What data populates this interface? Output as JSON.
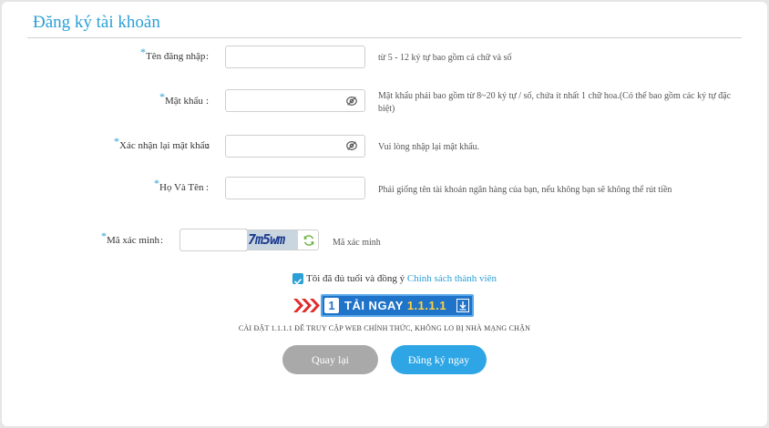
{
  "page": {
    "title": "Đăng ký tài khoản"
  },
  "form": {
    "username": {
      "required_mark": "*",
      "label": "Tên đăng nhập",
      "colon": ":",
      "value": "",
      "hint": "từ 5 - 12 ký tự bao gồm cả chữ và số"
    },
    "password": {
      "required_mark": "*",
      "label": "Mật khẩu",
      "colon": ":",
      "value": "",
      "hint": "Mật khẩu phải bao gồm từ 8~20 ký tự / số, chứa ít nhất 1 chữ hoa.(Có thể bao gồm các ký tự đặc biệt)",
      "icon": "eye-slash-icon"
    },
    "confirm_password": {
      "required_mark": "*",
      "label": "Xác nhận lại mật khẩu",
      "colon": ":",
      "value": "",
      "hint": "Vui lòng nhập lại mật khẩu.",
      "icon": "eye-slash-icon"
    },
    "full_name": {
      "required_mark": "*",
      "label": "Họ Và Tên",
      "colon": ":",
      "value": "",
      "hint": "Phải giống tên tài khoản ngân hàng của bạn, nếu không bạn sẽ không thể rút tiền"
    },
    "captcha": {
      "required_mark": "*",
      "label": "Mã xác minh",
      "colon": ":",
      "value": "",
      "captcha_text": "7m5wm",
      "hint": "Mã xác minh",
      "refresh_icon": "refresh-icon"
    },
    "agreement": {
      "checked": true,
      "text": "Tôi đã đủ tuổi và đồng ý",
      "link": "Chính sách thành viên"
    }
  },
  "banner": {
    "badge": "1",
    "text": "TẢI NGAY",
    "accent": "1.1.1.1",
    "note": "CÀI ĐẶT 1.1.1.1 ĐỂ TRUY CẬP WEB CHÍNH THỨC, KHÔNG LO BỊ NHÀ MẠNG CHẶN"
  },
  "actions": {
    "back_label": "Quay lại",
    "submit_label": "Đăng ký ngay"
  },
  "colors": {
    "accent": "#2b9fd6",
    "button_gray": "#a9a9a9",
    "button_blue": "#2ea6e6",
    "banner_blue": "#1f73c9"
  }
}
